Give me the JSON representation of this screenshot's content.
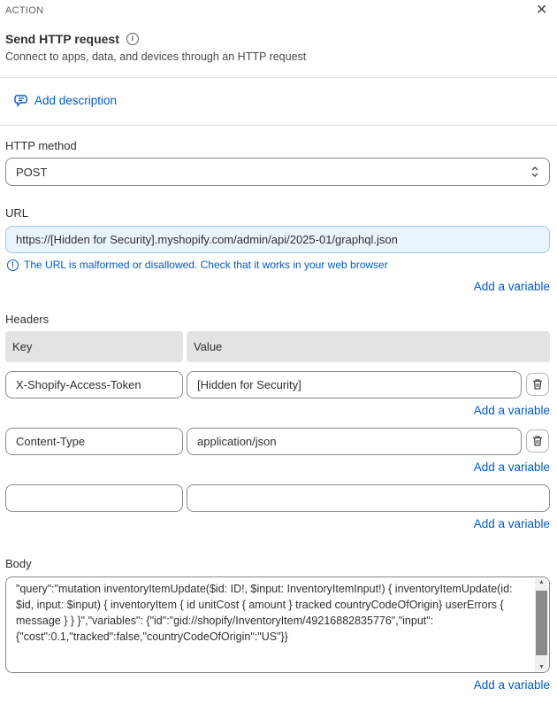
{
  "header": {
    "section": "ACTION",
    "title": "Send HTTP request",
    "subtitle": "Connect to apps, data, and devices through an HTTP request",
    "close_icon": "close-icon",
    "info_icon": "info-icon"
  },
  "description": {
    "add_label": "Add description",
    "icon": "comment-edit-icon"
  },
  "method": {
    "label": "HTTP method",
    "value": "POST",
    "icon": "select-chevron-icon"
  },
  "url": {
    "label": "URL",
    "value": "https://[Hidden for Security].myshopify.com/admin/api/2025-01/graphql.json",
    "error": "The URL is malformed or disallowed. Check that it works in your web browser",
    "add_variable": "Add a variable"
  },
  "headers": {
    "label": "Headers",
    "key_col": "Key",
    "value_col": "Value",
    "rows": [
      {
        "key": "X-Shopify-Access-Token",
        "value": "[Hidden for Security]",
        "add_variable": "Add a variable"
      },
      {
        "key": "Content-Type",
        "value": "application/json",
        "add_variable": "Add a variable"
      },
      {
        "key": "",
        "value": "",
        "add_variable": "Add a variable"
      }
    ]
  },
  "body": {
    "label": "Body",
    "value": "\"query\":\"mutation inventoryItemUpdate($id: ID!, $input: InventoryItemInput!) { inventoryItemUpdate(id: $id, input: $input) { inventoryItem { id unitCost { amount } tracked countryCodeOfOrigin} userErrors { message } } }\",\"variables\": {\"id\":\"gid://shopify/InventoryItem/49216882835776\",\"input\": {\"cost\":0.1,\"tracked\":false,\"countryCodeOfOrigin\":\"US\"}}",
    "add_variable": "Add a variable"
  },
  "colors": {
    "link": "#005bd3",
    "url_bg": "#eaf4ff",
    "header_cell": "#e3e3e3"
  }
}
